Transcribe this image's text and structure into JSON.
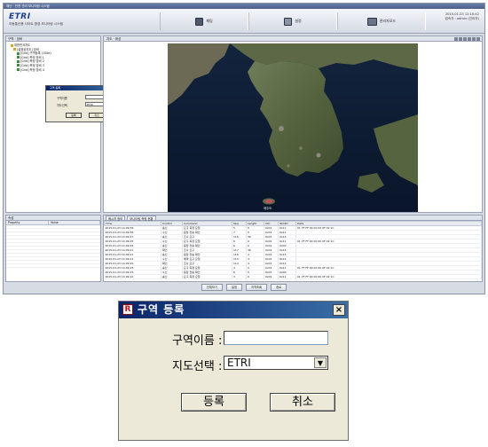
{
  "app": {
    "window_title": "재난 · 안전 관리 모니터링 시스템",
    "brand": {
      "logo": "ETRI",
      "system_name": "이동통신용 사이트 환경 모니터링 시스템"
    },
    "nav": [
      {
        "label": "채팅",
        "icon": "monitor-icon"
      },
      {
        "label": "설정",
        "icon": "settings-icon"
      },
      {
        "label": "관리자모드",
        "icon": "admin-group-icon"
      }
    ],
    "header_right": {
      "datetime": "2015-01-23 12:10:42",
      "user": "접속자 : admin (관리자)"
    },
    "left_tab": "구역 · 장비",
    "tree": [
      {
        "level": 1,
        "label": "대한민국지도"
      },
      {
        "level": 2,
        "label": "[설정된지도] 장비"
      },
      {
        "level": 3,
        "label": "[Grid] 구역등록 (1Site)"
      },
      {
        "level": 3,
        "label": "[Grid] 측정 장비 1"
      },
      {
        "level": 3,
        "label": "[Grid] 측정 장비 2"
      },
      {
        "level": 3,
        "label": "[Grid] 측정 장비 3"
      },
      {
        "level": 3,
        "label": "[Grid] 측정 장비 4"
      }
    ],
    "map_tab": "지도 · 위성",
    "map_label": "제주도",
    "prop_panel_tab": "속성",
    "prop_headers": [
      "Property",
      "Value"
    ],
    "log_tabs": [
      "메시지 정보",
      "모니터링 측정 현황"
    ],
    "log_headers": [
      "Time",
      "Control",
      "Command",
      "Seq",
      "Length",
      "Ctrl",
      "ID/UID",
      "Data"
    ],
    "log_rows": [
      [
        "2015-01-23 14:09:36",
        "송신",
        "요구 측정 요청",
        "5",
        "0",
        "0x01",
        "0x11",
        "01 7F FF 00 00 00 0F 02 1C"
      ],
      [
        "2015-01-23 14:09:36",
        "수신",
        "응답 전송 확인",
        "7",
        "0",
        "0x01",
        "0x11",
        ""
      ],
      [
        "2015-01-23 14:09:27",
        "송신",
        "조사 요구",
        "116",
        "36",
        "0x01",
        "0x14",
        ""
      ],
      [
        "2015-01-23 14:09:25",
        "수신",
        "요구 측정 요청",
        "6",
        "0",
        "0x01",
        "0x11",
        "01 7F FF 00 00 00 0F 02 1C"
      ],
      [
        "2015-01-23 14:09:25",
        "송신",
        "응답 전송 확인",
        "6",
        "0",
        "0x01",
        "0x00",
        ""
      ],
      [
        "2015-01-23 14:09:21",
        "확인",
        "조사 요구",
        "117",
        "36",
        "0x01",
        "0x14",
        ""
      ],
      [
        "2015-01-23 14:09:21",
        "송신",
        "응답 전송 확인",
        "116",
        "4",
        "0x01",
        "0x14",
        ""
      ],
      [
        "2015-01-23 14:09:21",
        "수신",
        "예약 요구 요청",
        "115",
        "4",
        "0x01",
        "0x14",
        ""
      ],
      [
        "2015-01-23 14:09:20",
        "확인",
        "조사 요구",
        "114",
        "4",
        "0x01",
        "0x14",
        ""
      ],
      [
        "2015-01-23 14:09:15",
        "송신",
        "요구 측정 요청",
        "4",
        "0",
        "0x01",
        "0x11",
        "01 7F FF 00 00 00 0F 02 1C"
      ],
      [
        "2015-01-23 14:09:15",
        "수신",
        "응답 전송 확인",
        "6",
        "0",
        "0x01",
        "0x00",
        ""
      ],
      [
        "2015-01-23 14:09:10",
        "송신",
        "요구 측정 요청",
        "3",
        "0",
        "0x01",
        "0x11",
        "01 7F FF 00 00 00 0F 02 1C"
      ]
    ],
    "bottom_buttons": [
      "전체보기",
      "설정",
      "지역조회",
      "종료"
    ],
    "mini_dialog": {
      "title": "구역 등록",
      "name_label": "구역이름",
      "name_value": "",
      "map_label": "지도선택",
      "map_value": "ETRI",
      "ok": "등록",
      "cancel": "취소"
    }
  },
  "dialog": {
    "title": "구역 등록",
    "icon": "R",
    "close": "×",
    "name_label": "구역이름 :",
    "name_value": "",
    "map_label": "지도선택 :",
    "map_value": "ETRI",
    "select_arrow": "▼",
    "register_button": "등록",
    "cancel_button": "취소"
  },
  "colors": {
    "title_bar_start": "#0a246a",
    "title_bar_end": "#3a6ea5",
    "dialog_face": "#ece9d8",
    "brand_blue": "#1b3f8f",
    "map_sea": "#0c1a2e"
  }
}
